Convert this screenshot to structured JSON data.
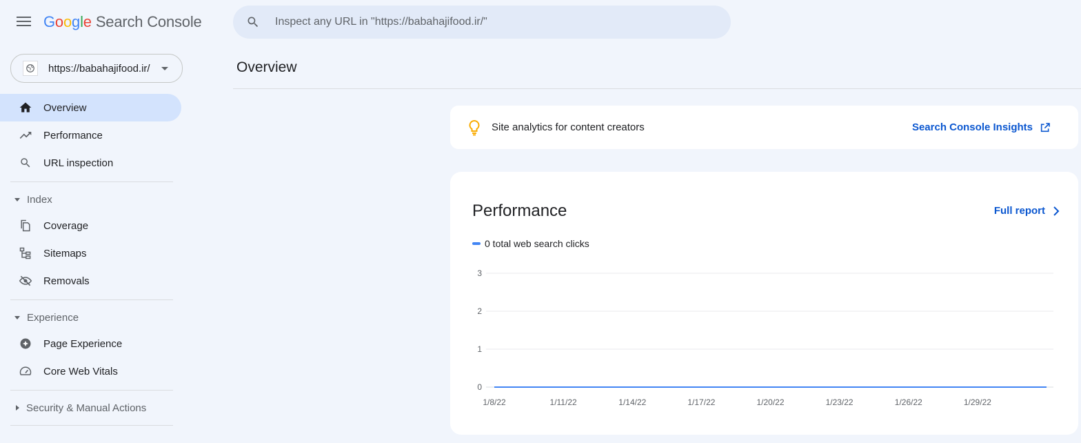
{
  "header": {
    "logo_letters": [
      {
        "ch": "G",
        "color": "#4285F4"
      },
      {
        "ch": "o",
        "color": "#EA4335"
      },
      {
        "ch": "o",
        "color": "#FBBC05"
      },
      {
        "ch": "g",
        "color": "#4285F4"
      },
      {
        "ch": "l",
        "color": "#34A853"
      },
      {
        "ch": "e",
        "color": "#EA4335"
      }
    ],
    "product_name": "Search Console",
    "search_placeholder": "Inspect any URL in \"https://babahajifood.ir/\""
  },
  "property": {
    "url": "https://babahajifood.ir/"
  },
  "sidebar": {
    "top_items": [
      {
        "label": "Overview",
        "icon": "home-icon",
        "active": true
      },
      {
        "label": "Performance",
        "icon": "trending-up-icon"
      },
      {
        "label": "URL inspection",
        "icon": "search-icon"
      }
    ],
    "sections": [
      {
        "label": "Index",
        "expanded": true,
        "items": [
          {
            "label": "Coverage",
            "icon": "file-copy-icon"
          },
          {
            "label": "Sitemaps",
            "icon": "sitemap-icon"
          },
          {
            "label": "Removals",
            "icon": "visibility-off-icon"
          }
        ]
      },
      {
        "label": "Experience",
        "expanded": true,
        "items": [
          {
            "label": "Page Experience",
            "icon": "page-experience-icon"
          },
          {
            "label": "Core Web Vitals",
            "icon": "speed-gauge-icon"
          }
        ]
      },
      {
        "label": "Security & Manual Actions",
        "expanded": false,
        "items": []
      }
    ]
  },
  "main": {
    "title": "Overview",
    "insights": {
      "text": "Site analytics for content creators",
      "link": "Search Console Insights"
    },
    "performance": {
      "title": "Performance",
      "full_report": "Full report",
      "legend": "0 total web search clicks"
    }
  },
  "chart_data": {
    "type": "line",
    "title": "",
    "xlabel": "",
    "ylabel": "",
    "ylim": [
      0,
      3
    ],
    "y_ticks": [
      0,
      1,
      2,
      3
    ],
    "x_tick_labels": [
      "1/8/22",
      "1/11/22",
      "1/14/22",
      "1/17/22",
      "1/20/22",
      "1/23/22",
      "1/26/22",
      "1/29/22"
    ],
    "grid": true,
    "series": [
      {
        "name": "0 total web search clicks",
        "color": "#4285f4",
        "x": [
          "1/8/22",
          "1/9/22",
          "1/10/22",
          "1/11/22",
          "1/12/22",
          "1/13/22",
          "1/14/22",
          "1/15/22",
          "1/16/22",
          "1/17/22",
          "1/18/22",
          "1/19/22",
          "1/20/22",
          "1/21/22",
          "1/22/22",
          "1/23/22",
          "1/24/22",
          "1/25/22",
          "1/26/22",
          "1/27/22",
          "1/28/22",
          "1/29/22",
          "1/30/22",
          "1/31/22",
          "2/1/22"
        ],
        "values": [
          0,
          0,
          0,
          0,
          0,
          0,
          0,
          0,
          0,
          0,
          0,
          0,
          0,
          0,
          0,
          0,
          0,
          0,
          0,
          0,
          0,
          0,
          0,
          0,
          0
        ]
      }
    ]
  }
}
